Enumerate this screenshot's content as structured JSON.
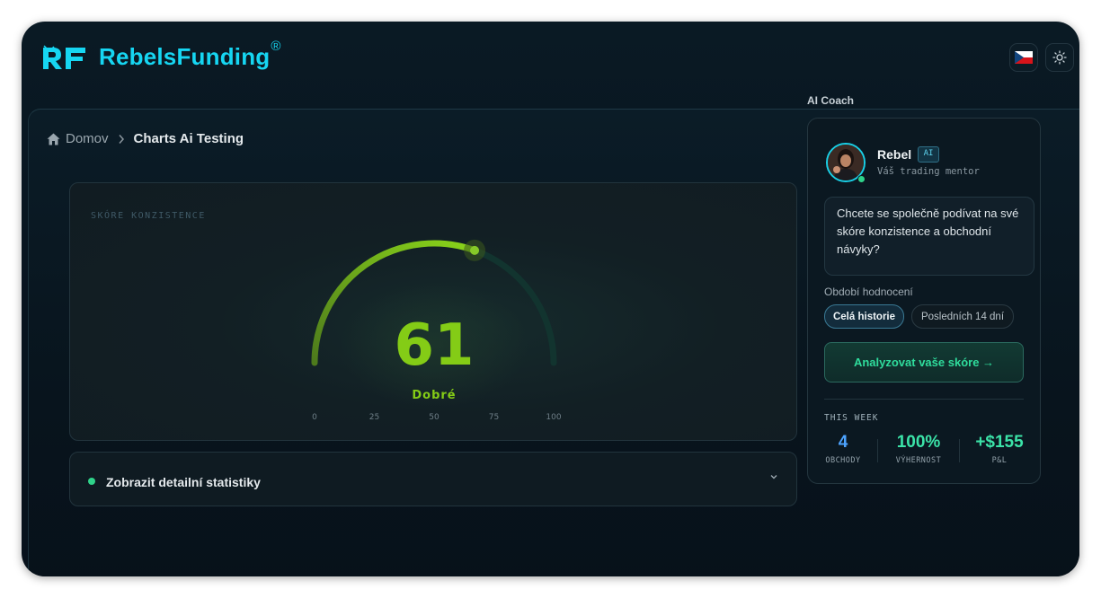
{
  "app": {
    "brand": "RebelsFunding",
    "brand_mark": "®"
  },
  "header": {
    "language_icon": "czech-flag-icon",
    "theme_icon": "sun-icon"
  },
  "breadcrumb": {
    "home_label": "Domov",
    "current_label": "Charts Ai Testing"
  },
  "score": {
    "label": "SKÓRE KONZISTENCE",
    "value": "61",
    "value_num": 61,
    "rating": "Dobré",
    "ticks": [
      "0",
      "25",
      "50",
      "75",
      "100"
    ],
    "accent_color": "#84cc16",
    "track_color": "#134e4a"
  },
  "stats_toggle": {
    "label": "Zobrazit detailní statistiky",
    "icon": "chevron-down-icon"
  },
  "coach": {
    "section_title": "AI Coach",
    "name": "Rebel",
    "badge": "AI",
    "subtitle": "Váš trading mentor",
    "message": "Chcete se společně podívat na své skóre konzistence a obchodní návyky?",
    "period_label": "Období hodnocení",
    "period_options": [
      "Celá historie",
      "Posledních 14 dní"
    ],
    "period_selected": "Celá historie",
    "analyze_button": "Analyzovat vaše skóre →"
  },
  "week": {
    "label": "THIS WEEK",
    "stats": [
      {
        "value": "4",
        "label": "OBCHODY",
        "color": "#4da3ff"
      },
      {
        "value": "100%",
        "label": "VÝHERNOST",
        "color": "#3be3a8"
      },
      {
        "value": "+$155",
        "label": "P&L",
        "color": "#3be3a8"
      }
    ]
  }
}
